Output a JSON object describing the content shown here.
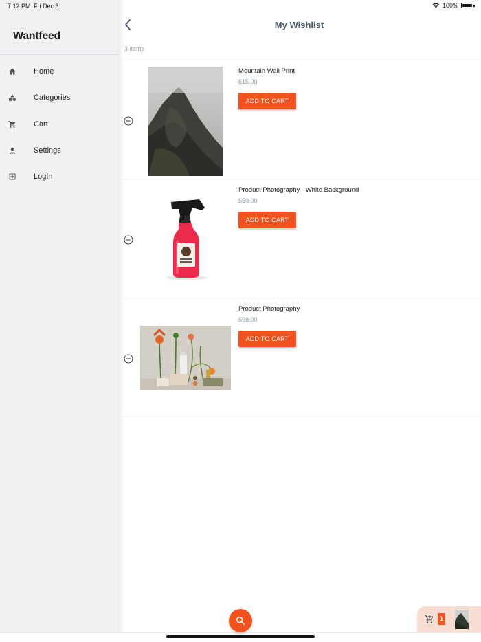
{
  "status_bar": {
    "time": "7:12 PM",
    "date": "Fri Dec 3",
    "battery": "100%",
    "battery_level": 1.0
  },
  "sidebar": {
    "brand": "Wantfeed",
    "items": [
      {
        "label": "Home",
        "icon": "home-icon"
      },
      {
        "label": "Categories",
        "icon": "categories-icon"
      },
      {
        "label": "Cart",
        "icon": "cart-icon"
      },
      {
        "label": "Settings",
        "icon": "person-icon"
      },
      {
        "label": "LogIn",
        "icon": "login-icon"
      }
    ]
  },
  "header": {
    "title": "My Wishlist",
    "back_icon": "chevron-left-icon"
  },
  "wishlist": {
    "count_text": "3 items",
    "add_label": "ADD TO CART",
    "items": [
      {
        "name": "Mountain Wall Print",
        "price": "$15.00"
      },
      {
        "name": "Product Photography - White Background",
        "price": "$50.00"
      },
      {
        "name": "Product Photography",
        "price": "$98.00"
      }
    ]
  },
  "cart_widget": {
    "count": "1"
  },
  "colors": {
    "accent": "#f2521d",
    "sidebar_bg": "#f0f1f3",
    "title": "#4a5a6a",
    "price": "#8a99a6",
    "cart_widget_bg": "#f8ddd2"
  }
}
